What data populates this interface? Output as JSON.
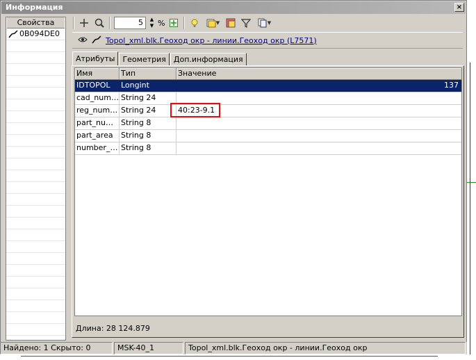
{
  "window": {
    "title": "Информация",
    "close_glyph": "×"
  },
  "left_panel": {
    "header": "Свойства",
    "items": [
      {
        "label": "0B094DE0",
        "icon": "polyline-icon"
      }
    ]
  },
  "toolbar": {
    "zoom_value": "5",
    "zoom_unit": "%"
  },
  "object": {
    "link_text": "Topol_xml.blk.Геоход окр - линии.Геоход окр  (L7571)"
  },
  "tabs": [
    {
      "label": "Атрибуты",
      "active": true
    },
    {
      "label": "Геометрия",
      "active": false
    },
    {
      "label": "Доп.информация",
      "active": false
    }
  ],
  "grid": {
    "columns": [
      "Имя",
      "Тип",
      "Значение"
    ],
    "rows": [
      {
        "name": "IDTOPOL",
        "type": "Longint",
        "value": "137"
      },
      {
        "name": "cad_number",
        "type": "String 24",
        "value": ""
      },
      {
        "name": "reg_numb...",
        "type": "String 24",
        "value": "40:23-9.1"
      },
      {
        "name": "part_num ...",
        "type": "String 8",
        "value": ""
      },
      {
        "name": "part_area",
        "type": "String 8",
        "value": ""
      },
      {
        "name": "number_pp",
        "type": "String 8",
        "value": ""
      }
    ]
  },
  "length_text": "Длина: 28 124.879",
  "status": {
    "found": "Найдено: 1  Скрыто: 0",
    "crs": "MSK-40_1",
    "layer": "Topol_xml.blk.Геоход окр - линии.Геоход окр"
  },
  "colors": {
    "selection": "#0a246a",
    "highlight_box": "#e01010",
    "link": "#000080"
  }
}
